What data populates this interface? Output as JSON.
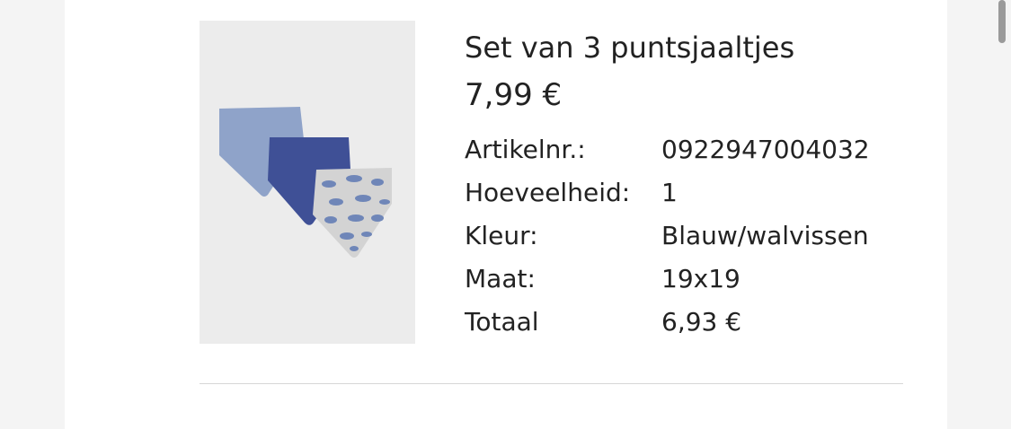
{
  "product": {
    "image_alt": "Set van 3 puntsjaaltjes",
    "title": "Set van 3 puntsjaaltjes",
    "price": "7,99 €",
    "details": [
      {
        "label": "Artikelnr.:",
        "value": "0922947004032"
      },
      {
        "label": "Hoeveelheid:",
        "value": "1"
      },
      {
        "label": "Kleur:",
        "value": "Blauw/walvissen"
      },
      {
        "label": "Maat:",
        "value": "19x19"
      },
      {
        "label": "Totaal",
        "value": "6,93 €"
      }
    ]
  },
  "colors": {
    "page_background": "#f4f4f4",
    "panel_background": "#ffffff",
    "image_background": "#ececec",
    "bib_light_blue": "#8fa3c9",
    "bib_dark_blue": "#3f5096",
    "bib_grey_print": "#d3d3d3",
    "whale_blue": "#6f86b8"
  },
  "icons": {
    "scrollbar": "scrollbar-thumb"
  }
}
